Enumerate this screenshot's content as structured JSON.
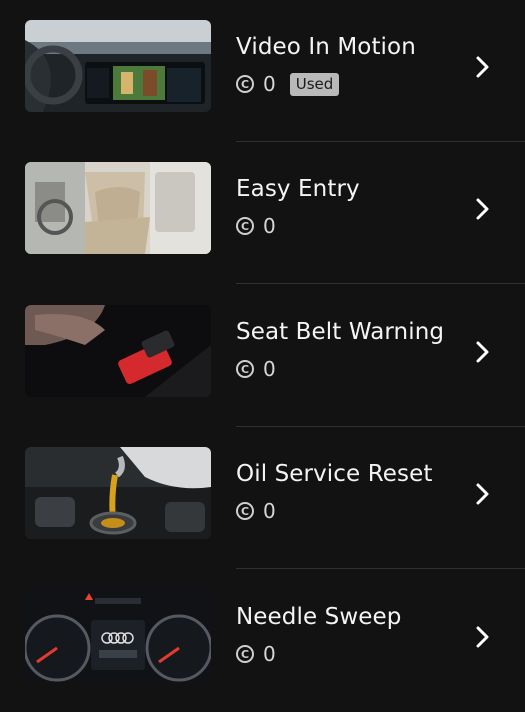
{
  "items": [
    {
      "title": "Video In Motion",
      "count": "0",
      "badge": "Used",
      "chevron_icon": "chevron-right-icon",
      "coin_icon": "coin-icon",
      "coin_glyph": "C"
    },
    {
      "title": "Easy Entry",
      "count": "0",
      "chevron_icon": "chevron-right-icon",
      "coin_icon": "coin-icon",
      "coin_glyph": "C"
    },
    {
      "title": "Seat Belt Warning",
      "count": "0",
      "chevron_icon": "chevron-right-icon",
      "coin_icon": "coin-icon",
      "coin_glyph": "C"
    },
    {
      "title": "Oil Service Reset",
      "count": "0",
      "chevron_icon": "chevron-right-icon",
      "coin_icon": "coin-icon",
      "coin_glyph": "C"
    },
    {
      "title": "Needle Sweep",
      "count": "0",
      "chevron_icon": "chevron-right-icon",
      "coin_icon": "coin-icon",
      "coin_glyph": "C"
    }
  ],
  "colors": {
    "background": "#121212",
    "divider": "#303030",
    "badge_bg": "#b9b9b9",
    "text": "#f4f4f4"
  }
}
